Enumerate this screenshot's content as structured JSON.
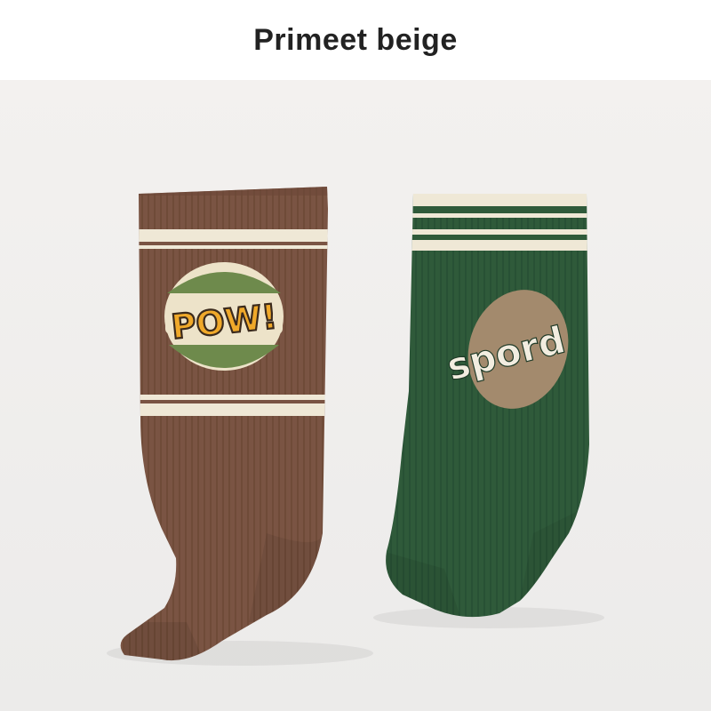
{
  "title": "Primeet beige",
  "products": [
    {
      "name": "brown-sock",
      "base_color": "#7a5443",
      "stripe_color": "#efe8d6",
      "patch": {
        "text": "POW!",
        "text_color": "#f0a92a",
        "circle_colors": [
          "#6e8a4c",
          "#ede3c9"
        ]
      }
    },
    {
      "name": "green-sock",
      "base_color": "#2f5a3a",
      "stripe_color": "#efe8d6",
      "patch": {
        "text": "spord",
        "text_color": "#f2ede0",
        "oval_color": "#a38a6d"
      }
    }
  ],
  "background_color": "#f1efed"
}
